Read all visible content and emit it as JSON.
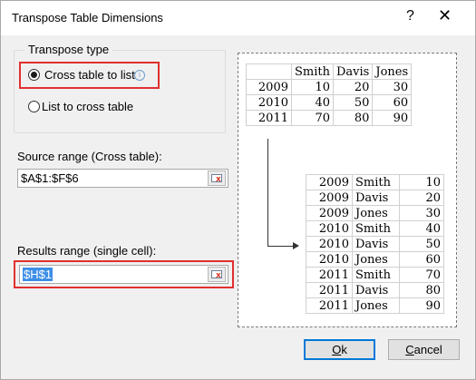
{
  "window": {
    "title": "Transpose Table Dimensions",
    "help": "?",
    "close": "✕"
  },
  "transpose_type": {
    "label": "Transpose type",
    "option1": "Cross table to list",
    "option2": "List to cross table",
    "selected": "Cross table to list"
  },
  "source": {
    "label": "Source range (Cross table):",
    "value": "$A$1:$F$6"
  },
  "results": {
    "label": "Results range (single cell):",
    "value": "$H$1"
  },
  "cross_table": {
    "headers": [
      "",
      "Smith",
      "Davis",
      "Jones"
    ],
    "rows": [
      [
        "2009",
        "10",
        "20",
        "30"
      ],
      [
        "2010",
        "40",
        "50",
        "60"
      ],
      [
        "2011",
        "70",
        "80",
        "90"
      ]
    ]
  },
  "list_table": {
    "rows": [
      [
        "2009",
        "Smith",
        "10"
      ],
      [
        "2009",
        "Davis",
        "20"
      ],
      [
        "2009",
        "Jones",
        "30"
      ],
      [
        "2010",
        "Smith",
        "40"
      ],
      [
        "2010",
        "Davis",
        "50"
      ],
      [
        "2010",
        "Jones",
        "60"
      ],
      [
        "2011",
        "Smith",
        "70"
      ],
      [
        "2011",
        "Davis",
        "80"
      ],
      [
        "2011",
        "Jones",
        "90"
      ]
    ]
  },
  "buttons": {
    "ok_key": "O",
    "ok_rest": "k",
    "cancel_key": "C",
    "cancel_rest": "ancel"
  }
}
